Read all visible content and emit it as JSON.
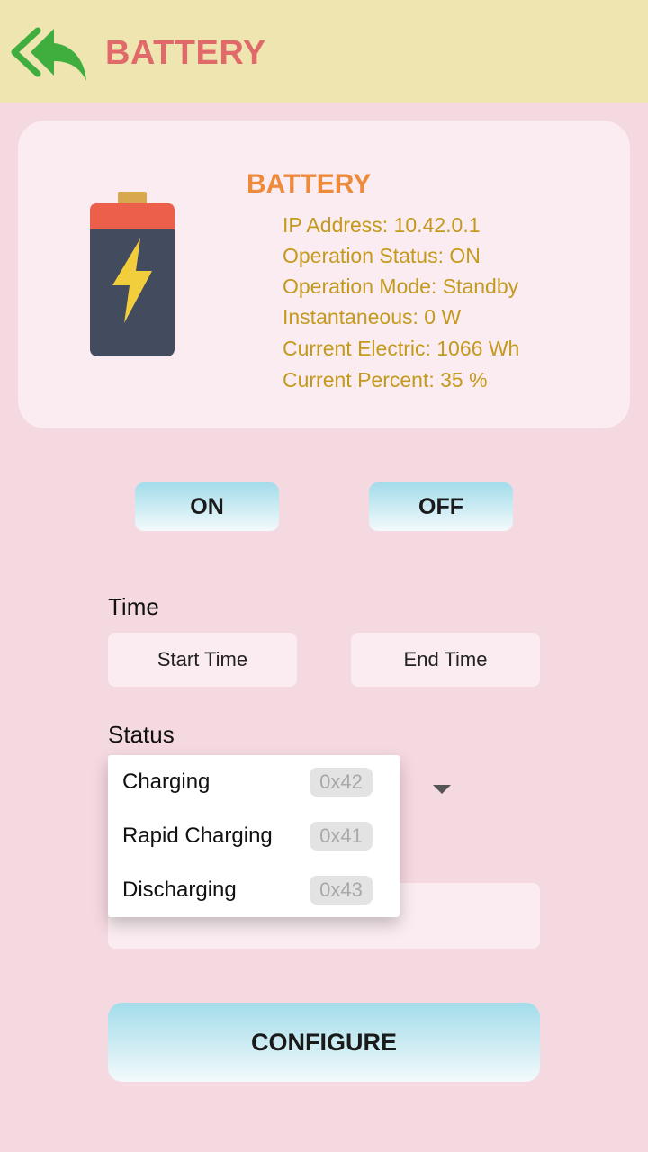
{
  "header": {
    "title": "BATTERY",
    "back_icon": "back-arrow-icon",
    "back_icon_color": "#3fae3f"
  },
  "device": {
    "icon": "battery-icon",
    "title": "BATTERY",
    "info": [
      "IP Address: 10.42.0.1",
      "Operation Status: ON",
      "Operation Mode: Standby",
      "Instantaneous: 0 W",
      "Current Electric: 1066 Wh",
      "Current Percent: 35 %"
    ]
  },
  "controls": {
    "on_label": "ON",
    "off_label": "OFF"
  },
  "time": {
    "label": "Time",
    "start_label": "Start Time",
    "end_label": "End Time"
  },
  "status": {
    "label": "Status",
    "options": [
      {
        "label": "Charging",
        "code": "0x42"
      },
      {
        "label": "Rapid Charging",
        "code": "0x41"
      },
      {
        "label": "Discharging",
        "code": "0x43"
      }
    ]
  },
  "configure_label": "CONFIGURE",
  "colors": {
    "background": "#f5d9e0",
    "header_bg": "#efe5b0",
    "header_title": "#e06a6a",
    "card_title": "#ee8a3c",
    "info_text": "#c49a1e",
    "button_gradient_top": "#a3dcea"
  }
}
